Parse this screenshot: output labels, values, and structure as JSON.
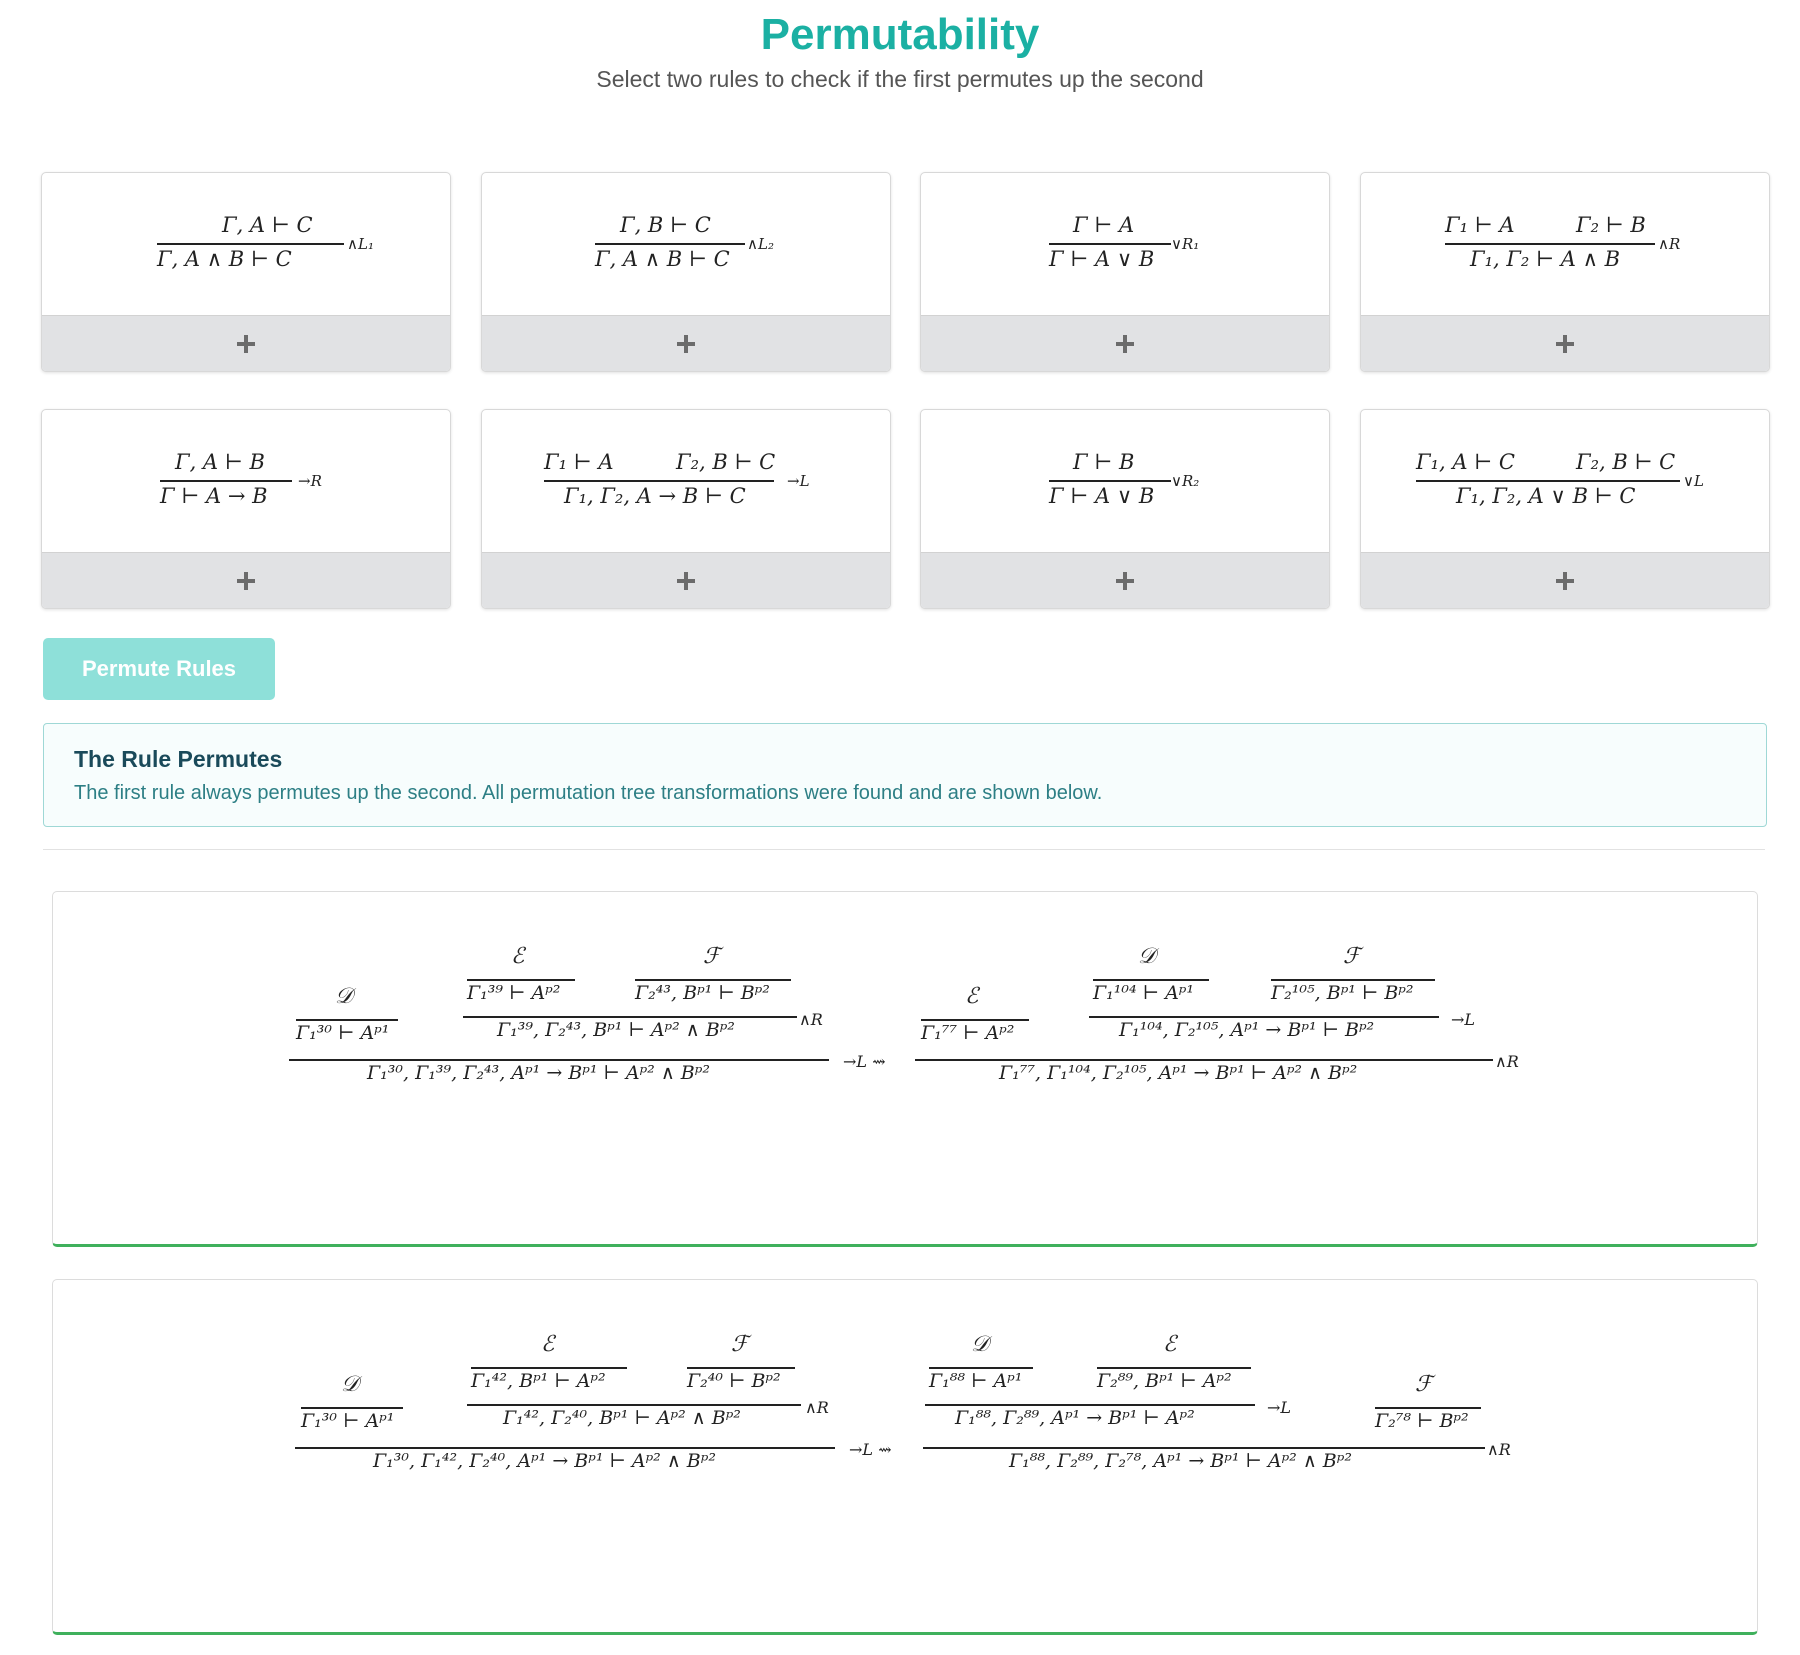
{
  "header": {
    "title": "Permutability",
    "subtitle": "Select two rules to check if the first permutes up the second"
  },
  "rules": [
    {
      "premises": [
        "Γ, A ⊢ C"
      ],
      "conclusion": "Γ, A ∧ B ⊢ C",
      "label": "∧L₁"
    },
    {
      "premises": [
        "Γ, B ⊢ C"
      ],
      "conclusion": "Γ, A ∧ B ⊢ C",
      "label": "∧L₂"
    },
    {
      "premises": [
        "Γ ⊢ A"
      ],
      "conclusion": "Γ ⊢ A ∨ B",
      "label": "∨R₁"
    },
    {
      "premises": [
        "Γ₁ ⊢ A",
        "Γ₂ ⊢ B"
      ],
      "conclusion": "Γ₁, Γ₂ ⊢ A ∧ B",
      "label": "∧R"
    },
    {
      "premises": [
        "Γ, A ⊢ B"
      ],
      "conclusion": "Γ ⊢ A → B",
      "label": "→R"
    },
    {
      "premises": [
        "Γ₁ ⊢ A",
        "Γ₂, B ⊢ C"
      ],
      "conclusion": "Γ₁, Γ₂, A → B ⊢ C",
      "label": "→L"
    },
    {
      "premises": [
        "Γ ⊢ B"
      ],
      "conclusion": "Γ ⊢ A ∨ B",
      "label": "∨R₂"
    },
    {
      "premises": [
        "Γ₁, A ⊢ C",
        "Γ₂, B ⊢ C"
      ],
      "conclusion": "Γ₁, Γ₂, A ∨ B ⊢ C",
      "label": "∨L"
    }
  ],
  "actions": {
    "permute_label": "Permute Rules",
    "add_icon": "plus-icon"
  },
  "result": {
    "heading": "The Rule Permutes",
    "message": "The first rule always permutes up the second. All permutation tree transformations were found and are shown below."
  },
  "transformations": [
    {
      "left": {
        "d": "𝒟",
        "e": "ℰ",
        "f": "ℱ",
        "d_seq": "Γ₁³⁰ ⊢ Aᵖ¹",
        "e_seq": "Γ₁³⁹ ⊢ Aᵖ²",
        "f_seq": "Γ₂⁴³, Bᵖ¹ ⊢ Bᵖ²",
        "inner": "Γ₁³⁹, Γ₂⁴³, Bᵖ¹ ⊢ Aᵖ² ∧ Bᵖ²",
        "inner_label": "∧R",
        "root": "Γ₁³⁰, Γ₁³⁹, Γ₂⁴³, Aᵖ¹ → Bᵖ¹ ⊢ Aᵖ² ∧ Bᵖ²",
        "root_label": "→L ⇝"
      },
      "right": {
        "d": "𝒟",
        "e": "ℰ",
        "f": "ℱ",
        "e_seq": "Γ₁⁷⁷ ⊢ Aᵖ²",
        "d_seq": "Γ₁¹⁰⁴ ⊢ Aᵖ¹",
        "f_seq": "Γ₂¹⁰⁵, Bᵖ¹ ⊢ Bᵖ²",
        "inner": "Γ₁¹⁰⁴, Γ₂¹⁰⁵, Aᵖ¹ → Bᵖ¹ ⊢ Bᵖ²",
        "inner_label": "→L",
        "root": "Γ₁⁷⁷, Γ₁¹⁰⁴, Γ₂¹⁰⁵, Aᵖ¹ → Bᵖ¹ ⊢ Aᵖ² ∧ Bᵖ²",
        "root_label": "∧R"
      }
    },
    {
      "left": {
        "d": "𝒟",
        "e": "ℰ",
        "f": "ℱ",
        "d_seq": "Γ₁³⁰ ⊢ Aᵖ¹",
        "e_seq": "Γ₁⁴², Bᵖ¹ ⊢ Aᵖ²",
        "f_seq": "Γ₂⁴⁰ ⊢ Bᵖ²",
        "inner": "Γ₁⁴², Γ₂⁴⁰, Bᵖ¹ ⊢ Aᵖ² ∧ Bᵖ²",
        "inner_label": "∧R",
        "root": "Γ₁³⁰, Γ₁⁴², Γ₂⁴⁰, Aᵖ¹ → Bᵖ¹ ⊢ Aᵖ² ∧ Bᵖ²",
        "root_label": "→L ⇝"
      },
      "right": {
        "d": "𝒟",
        "e": "ℰ",
        "f": "ℱ",
        "d_seq": "Γ₁⁸⁸ ⊢ Aᵖ¹",
        "e_seq": "Γ₂⁸⁹, Bᵖ¹ ⊢ Aᵖ²",
        "f_seq": "Γ₂⁷⁸ ⊢ Bᵖ²",
        "inner": "Γ₁⁸⁸, Γ₂⁸⁹, Aᵖ¹ → Bᵖ¹ ⊢ Aᵖ²",
        "inner_label": "→L",
        "root": "Γ₁⁸⁸, Γ₂⁸⁹, Γ₂⁷⁸, Aᵖ¹ → Bᵖ¹ ⊢ Aᵖ² ∧ Bᵖ²",
        "root_label": "∧R"
      }
    }
  ],
  "colors": {
    "accent": "#1bb0a3",
    "button": "#8ee0d9",
    "success_border": "#3fb05c"
  }
}
